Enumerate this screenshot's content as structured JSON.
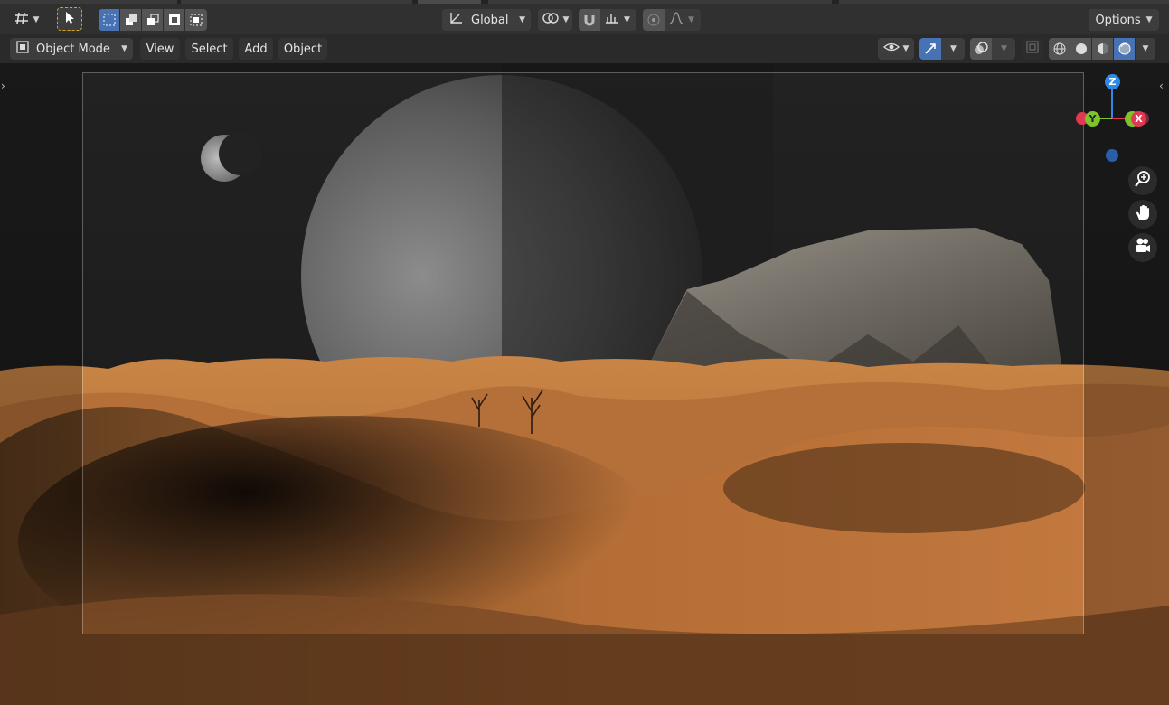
{
  "tool_header": {
    "editor_type_icon": "transform-tool-icon",
    "select_tool_icon": "cursor-icon",
    "select_modes": [
      "select-new-icon",
      "select-extend-icon",
      "select-subtract-icon",
      "select-invert-icon",
      "select-intersect-icon"
    ],
    "orientation_label": "Global",
    "pivot_icon": "pivot-icon",
    "snap_icon": "snap-magnet-icon",
    "snap_target_icon": "snap-increment-icon",
    "proportional_icon": "proportional-editing-icon",
    "falloff_icon": "falloff-curve-icon",
    "options_label": "Options"
  },
  "viewport_header": {
    "mode_label": "Object Mode",
    "menus": [
      "View",
      "Select",
      "Add",
      "Object"
    ],
    "visibility_icon": "eye-icon",
    "gizmo_icon": "gizmo-icon",
    "overlay_icon": "overlay-icon",
    "xray_icon": "xray-icon",
    "shading_modes": [
      "wireframe-icon",
      "solid-icon",
      "material-preview-icon",
      "rendered-icon"
    ]
  },
  "gizmo": {
    "axes": [
      "Z",
      "Y",
      "X"
    ],
    "colors": {
      "x": "#e03a52",
      "y": "#7ec22c",
      "z": "#2e8ae6",
      "neg_z": "#2a5ea8"
    }
  },
  "navigation": [
    "zoom-icon",
    "hand-pan-icon",
    "camera-icon"
  ],
  "colors": {
    "accent": "#4772b3",
    "header": "#303030",
    "sand": "#c47a3f"
  }
}
